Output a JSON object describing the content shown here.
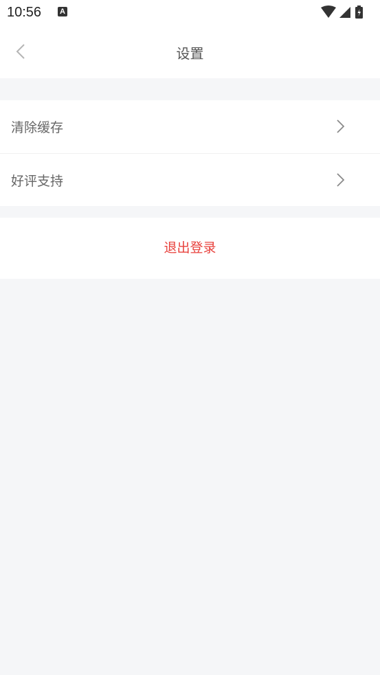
{
  "status_bar": {
    "time": "10:56",
    "notification_icon": "a-icon",
    "icons": [
      "wifi-icon",
      "signal-icon",
      "battery-charging-icon"
    ]
  },
  "header": {
    "title": "设置",
    "back_icon": "chevron-left-icon"
  },
  "settings": {
    "items": [
      {
        "label": "清除缓存",
        "icon": "chevron-right-icon"
      },
      {
        "label": "好评支持",
        "icon": "chevron-right-icon"
      }
    ]
  },
  "logout": {
    "label": "退出登录",
    "color": "#e8413c"
  },
  "colors": {
    "background": "#f5f6f8",
    "surface": "#ffffff",
    "text": "#666666"
  }
}
